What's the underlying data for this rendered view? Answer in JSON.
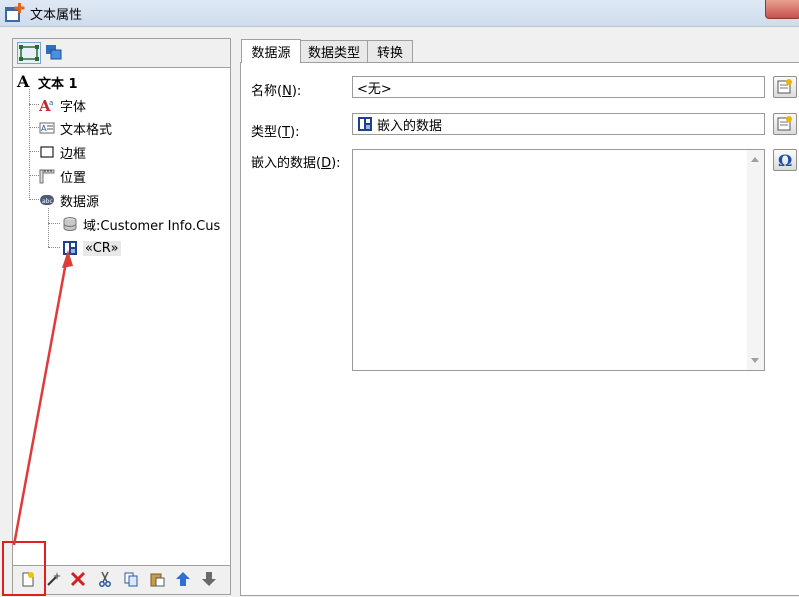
{
  "window": {
    "title": "文本属性"
  },
  "tree": {
    "root": "文本 1",
    "items": [
      {
        "label": "字体",
        "icon": "font-icon"
      },
      {
        "label": "文本格式",
        "icon": "text-format-icon"
      },
      {
        "label": "边框",
        "icon": "border-icon"
      },
      {
        "label": "位置",
        "icon": "position-icon"
      },
      {
        "label": "数据源",
        "icon": "datasource-icon"
      }
    ],
    "children": [
      {
        "label": "域:Customer Info.Cus",
        "icon": "database-icon"
      },
      {
        "label": "«CR»",
        "icon": "embedded-data-icon"
      }
    ]
  },
  "tabs": [
    "数据源",
    "数据类型",
    "转换"
  ],
  "form": {
    "name_label": "名称",
    "name_key": "N",
    "name_value": "<无>",
    "type_label": "类型",
    "type_key": "T",
    "type_value": "嵌入的数据",
    "data_label": "嵌入的数据",
    "data_key": "D",
    "data_value": ""
  }
}
